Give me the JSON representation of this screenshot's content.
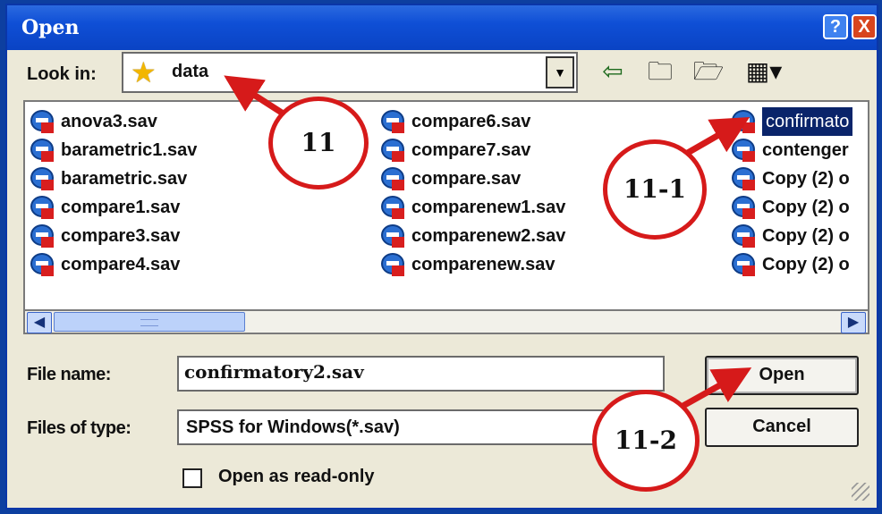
{
  "window": {
    "title": "Open",
    "help_glyph": "?",
    "close_glyph": "X"
  },
  "lookin": {
    "label": "Look in:",
    "value": "data",
    "dropdown_glyph": "▼"
  },
  "toolbar": {
    "back_glyph": "⇦",
    "up_glyph": "🗀",
    "new_folder_glyph": "🗁",
    "view_glyph": "▦▾"
  },
  "files": [
    {
      "name": "anova3.sav"
    },
    {
      "name": "barametric1.sav"
    },
    {
      "name": "barametric.sav"
    },
    {
      "name": "compare1.sav"
    },
    {
      "name": "compare3.sav"
    },
    {
      "name": "compare4.sav"
    },
    {
      "name": "compare6.sav"
    },
    {
      "name": "compare7.sav"
    },
    {
      "name": "compare.sav"
    },
    {
      "name": "comparenew1.sav"
    },
    {
      "name": "comparenew2.sav"
    },
    {
      "name": "comparenew.sav"
    },
    {
      "name": "confirmato",
      "selected": true
    },
    {
      "name": "contenger"
    },
    {
      "name": "Copy (2) o"
    },
    {
      "name": "Copy (2) o"
    },
    {
      "name": "Copy (2) o"
    },
    {
      "name": "Copy (2) o"
    }
  ],
  "scrollbar": {
    "left_glyph": "◀",
    "right_glyph": "▶"
  },
  "filename": {
    "label": "File name:",
    "value": "confirmatory2.sav"
  },
  "filetype": {
    "label": "Files of type:",
    "value": "SPSS for Windows(*.sav)"
  },
  "buttons": {
    "open": "Open",
    "cancel": "Cancel"
  },
  "readonly": {
    "label": "Open as read-only",
    "checked": false
  },
  "annotations": {
    "c11": "11",
    "c111": "11-1",
    "c112": "11-2",
    "accent_color": "#d61a1a"
  }
}
